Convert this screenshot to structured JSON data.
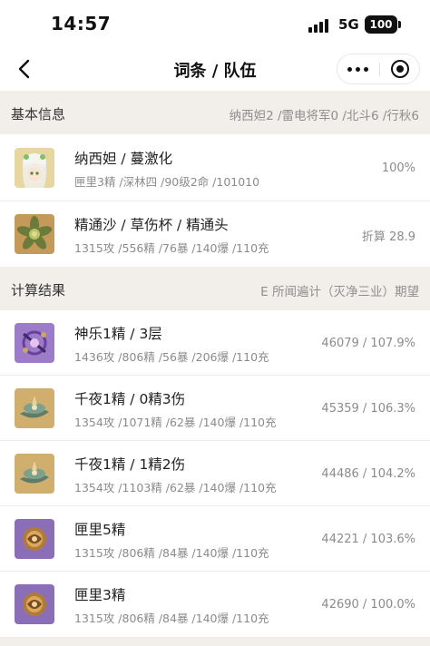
{
  "status": {
    "time": "14:57",
    "network": "5G",
    "battery": "100"
  },
  "nav": {
    "title": "词条 / 队伍"
  },
  "basic": {
    "title": "基本信息",
    "team": "纳西妲2 /雷电将军0 /北斗6 /行秋6",
    "character": {
      "name": "纳西妲 / 蔓激化",
      "stats": "匣里3精 /深林四 /90级2命 /101010",
      "value": "100%"
    },
    "artifacts": {
      "name": "精通沙 / 草伤杯 / 精通头",
      "stats": "1315攻 /556精 /76暴 /140爆 /110充",
      "value": "折算 28.9"
    }
  },
  "results": {
    "title": "计算结果",
    "desc": "E 所闻遍计（灭净三业）期望",
    "items": [
      {
        "name": "神乐1精 / 3层",
        "stats": "1436攻 /806精 /56暴 /206爆 /110充",
        "value": "46079 / 107.9%"
      },
      {
        "name": "千夜1精 / 0精3伤",
        "stats": "1354攻 /1071精 /62暴 /140爆 /110充",
        "value": "45359 / 106.3%"
      },
      {
        "name": "千夜1精 / 1精2伤",
        "stats": "1354攻 /1103精 /62暴 /140爆 /110充",
        "value": "44486 / 104.2%"
      },
      {
        "name": "匣里5精",
        "stats": "1315攻 /806精 /84暴 /140爆 /110充",
        "value": "44221 / 103.6%"
      },
      {
        "name": "匣里3精",
        "stats": "1315攻 /806精 /84暴 /140爆 /110充",
        "value": "42690 / 100.0%"
      }
    ]
  },
  "colors": {
    "section_bg": "#f2efea",
    "muted_text": "#8b8b8b",
    "weapon_purple": "#8a6fb8",
    "weapon_gold": "#c9a45c"
  },
  "icons": [
    "back-arrow-icon",
    "more-dots-icon",
    "close-circle-icon",
    "nahida-portrait",
    "flower-artifact-icon",
    "kagura-weapon-icon",
    "thousand-nights-weapon-icon",
    "mappa-mare-weapon-icon"
  ]
}
